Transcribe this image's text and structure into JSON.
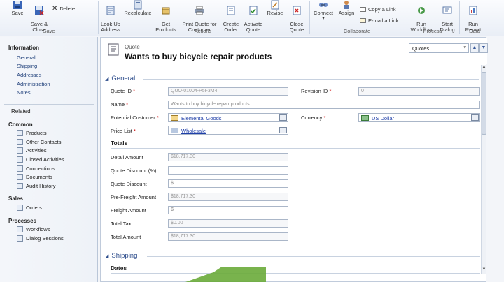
{
  "ribbon": {
    "save": "Save",
    "save_close": "Save &\nClose",
    "delete": "Delete",
    "save_group": "Save",
    "look_up": "Look Up\nAddress",
    "recalculate": "Recalculate",
    "get_products": "Get\nProducts",
    "print_quote": "Print Quote for\nCustomer",
    "create_order": "Create\nOrder",
    "activate_quote": "Activate\nQuote",
    "revise": "Revise",
    "close_quote": "Close\nQuote",
    "actions_group": "Actions",
    "connect": "Connect",
    "assign": "Assign",
    "copy_link": "Copy a Link",
    "email_link": "E-mail a Link",
    "collaborate_group": "Collaborate",
    "run_workflow": "Run\nWorkflow",
    "start_dialog": "Start\nDialog",
    "process_group": "Process",
    "run_report": "Run\nReport",
    "data_group": "Data"
  },
  "leftnav": {
    "information": "Information",
    "info_items": [
      "General",
      "Shipping",
      "Addresses",
      "Administration",
      "Notes"
    ],
    "related": "Related",
    "common": "Common",
    "common_items": [
      "Products",
      "Other Contacts",
      "Activities",
      "Closed Activities",
      "Connections",
      "Documents",
      "Audit History"
    ],
    "sales": "Sales",
    "sales_items": [
      "Orders"
    ],
    "processes": "Processes",
    "process_items": [
      "Workflows",
      "Dialog Sessions"
    ]
  },
  "header": {
    "entity": "Quote",
    "title": "Wants to buy bicycle repair products",
    "selector": "Quotes"
  },
  "general": {
    "heading": "General",
    "quote_id_label": "Quote ID",
    "quote_id": "QUO-01004-P5F3M4",
    "revision_label": "Revision ID",
    "revision": "0",
    "name_label": "Name",
    "name": "Wants to buy bicycle repair products",
    "customer_label": "Potential Customer",
    "customer": "Elemental Goods",
    "currency_label": "Currency",
    "currency": "US Dollar",
    "pricelist_label": "Price List",
    "pricelist": "Wholesale"
  },
  "totals": {
    "heading": "Totals",
    "rows": [
      {
        "label": "Detail Amount",
        "value": "$18,717.30"
      },
      {
        "label": "Quote Discount (%)",
        "value": ""
      },
      {
        "label": "Quote Discount",
        "value": "$"
      },
      {
        "label": "Pre-Freight Amount",
        "value": "$18,717.30"
      },
      {
        "label": "Freight Amount",
        "value": "$"
      },
      {
        "label": "Total Tax",
        "value": "$0.00"
      },
      {
        "label": "Total Amount",
        "value": "$18,717.30"
      }
    ]
  },
  "shipping": {
    "heading": "Shipping",
    "dates": "Dates"
  },
  "colors": {
    "accent": "#2a4a8a",
    "link": "#1f3fa8",
    "arrow": "#6aab3a"
  }
}
